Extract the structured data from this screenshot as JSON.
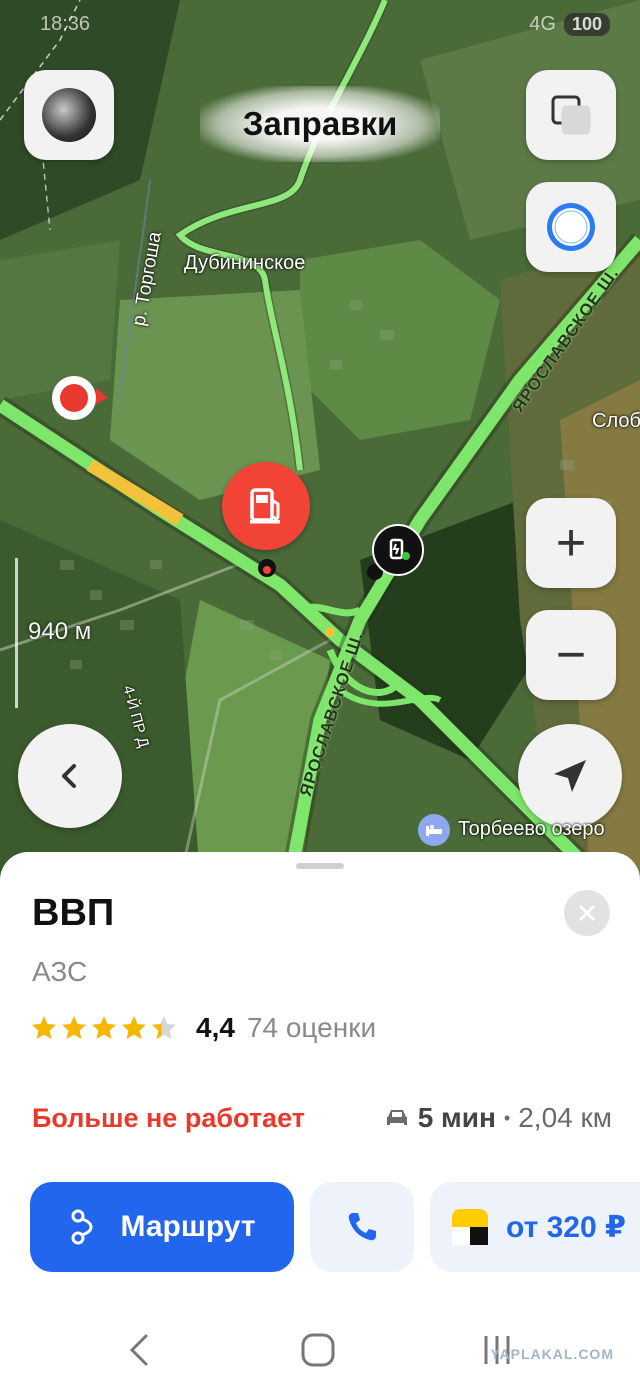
{
  "status_bar": {
    "time": "18:36",
    "network": "4G",
    "battery": "100"
  },
  "map": {
    "title": "Заправки",
    "labels": {
      "village": "Дубининское",
      "river": "р. Торгоша",
      "highway_upper": "ЯРОСЛАВСКОЕ Ш.",
      "highway_lower": "ЯРОСЛАВСКОЕ Ш.",
      "settlement_right": "Слоб",
      "street": "4-Й ПР Д",
      "poi": "Торбеево озеро"
    },
    "scale": "940 м",
    "controls": {
      "layers_icon": "layers-icon",
      "assistant_icon": "alice-icon",
      "zoom_in": "+",
      "zoom_out": "−",
      "back_icon": "chevron-left-icon",
      "locate_icon": "navigation-arrow-icon"
    },
    "pins": {
      "selected": "fuel-station-icon",
      "other": "electric-charging-icon",
      "poi_icon": "bed-icon"
    }
  },
  "place": {
    "name": "ВВП",
    "category": "АЗС",
    "rating": "4,4",
    "rating_stars": 4.4,
    "rating_count": "74 оценки",
    "status": "Больше не работает",
    "eta_time": "5 мин",
    "eta_separator": "•",
    "distance": "2,04 км"
  },
  "actions": {
    "route_label": "Маршрут",
    "call_icon": "phone-icon",
    "taxi_label": "от 320 ₽"
  },
  "watermark": "YAPLAKAL.COM",
  "colors": {
    "accent_blue": "#2266ee",
    "closed_red": "#e8392c",
    "pin_red": "#f24436",
    "traffic_green": "#7ee66a",
    "star_yellow": "#f5b800"
  }
}
